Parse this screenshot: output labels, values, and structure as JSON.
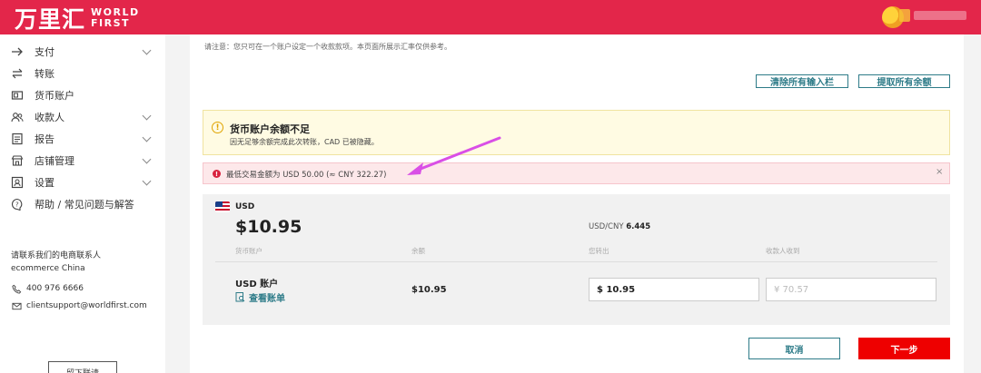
{
  "header": {
    "logo_cn": "万里汇",
    "logo_en_line1": "WORLD",
    "logo_en_line2": "FIRST",
    "user_name": "████████"
  },
  "sidebar": {
    "items": [
      {
        "label": "支付",
        "icon": "arrow-right-icon",
        "has_submenu": true
      },
      {
        "label": "转账",
        "icon": "transfer-icon",
        "has_submenu": false
      },
      {
        "label": "货币账户",
        "icon": "wallet-icon",
        "has_submenu": false
      },
      {
        "label": "收款人",
        "icon": "people-icon",
        "has_submenu": true
      },
      {
        "label": "报告",
        "icon": "report-icon",
        "has_submenu": true
      },
      {
        "label": "店铺管理",
        "icon": "store-icon",
        "has_submenu": true
      },
      {
        "label": "设置",
        "icon": "settings-icon",
        "has_submenu": true
      },
      {
        "label": "帮助 / 常见问题与解答",
        "icon": "help-icon",
        "has_submenu": false
      }
    ],
    "contact_title": "请联系我们的电商联系人",
    "contact_sub": "ecommerce China",
    "phone": "400 976 6666",
    "email": "clientsupport@worldfirst.com",
    "download_label": "留下联请"
  },
  "main": {
    "notice": "请注意：您只可在一个账户设定一个收款款项。本页面所展示汇率仅供参考。",
    "clear_inputs_label": "清除所有输入栏",
    "withdraw_all_label": "提取所有余额",
    "warning": {
      "title": "货币账户余额不足",
      "text": "因无足够余额完成此次转账，CAD 已被隐藏。"
    },
    "error": {
      "text": "最低交易金额为 USD 50.00 (≈ CNY 322.27)",
      "close": "×"
    },
    "account": {
      "currency_code": "USD",
      "balance": "$10.95",
      "rate_label": "USD/CNY",
      "rate_value": "6.445",
      "col_account": "货币账户",
      "col_balance": "余额",
      "col_send": "您转出",
      "col_receive": "收款人收到",
      "account_name": "USD 账户",
      "statement_link": "查看账单",
      "row_balance": "$10.95",
      "send_value": "$ 10.95",
      "receive_placeholder": "¥ 70.57"
    },
    "cancel_label": "取消",
    "next_label": "下一步"
  },
  "colors": {
    "brand_red": "#e3264a",
    "accent_teal": "#2d7b88",
    "next_red": "#ee0000",
    "annotation_arrow": "#d94fe6"
  }
}
